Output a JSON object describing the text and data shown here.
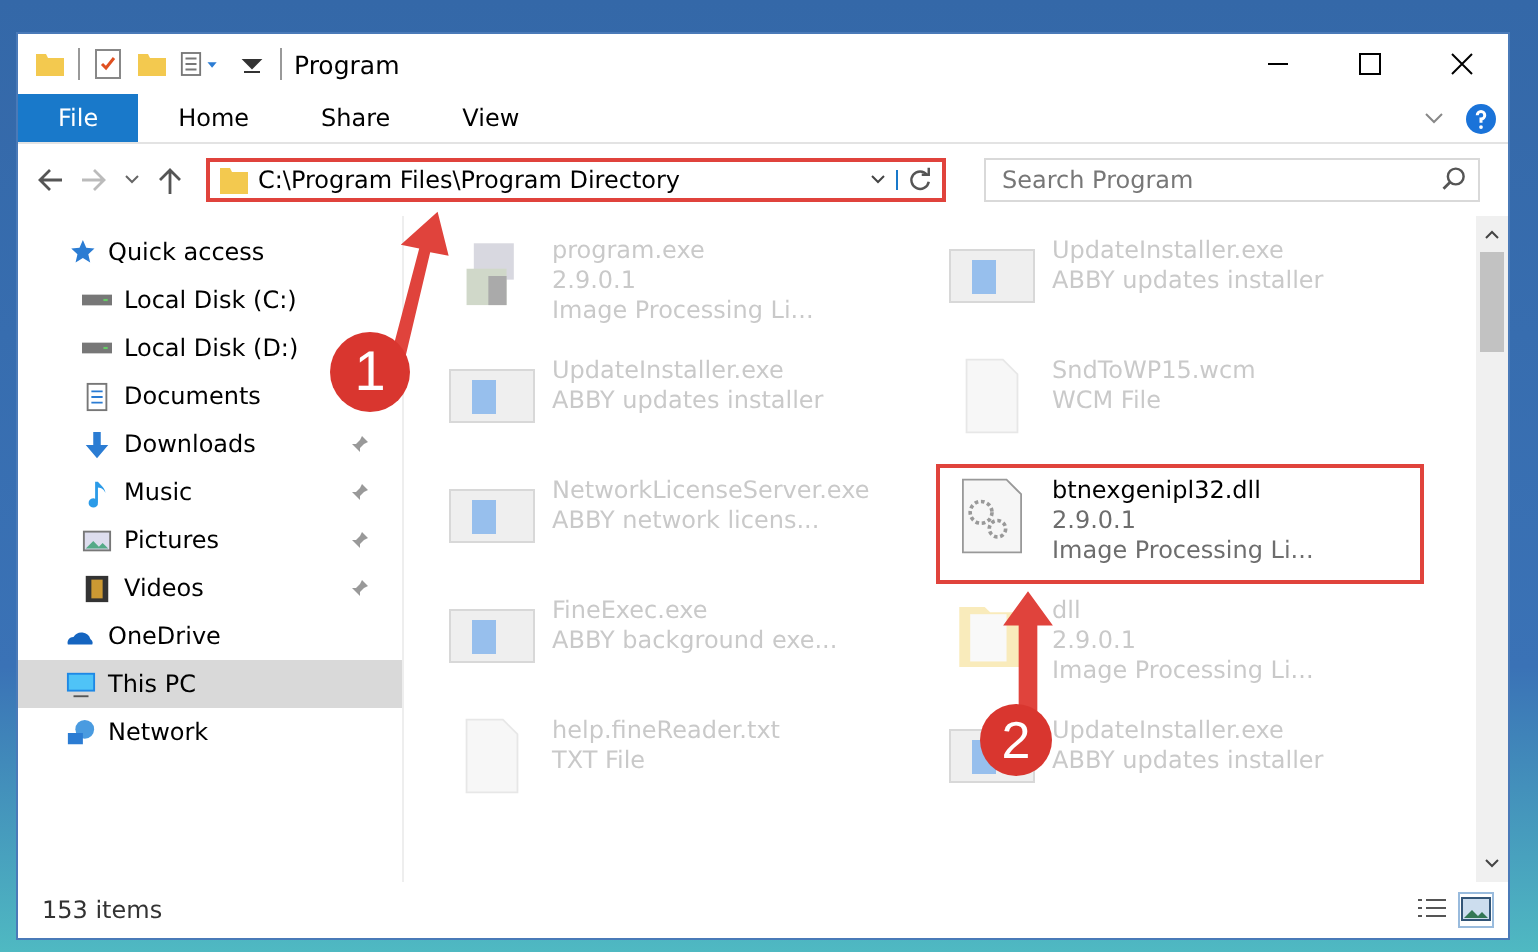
{
  "window": {
    "title": "Program"
  },
  "ribbon_tabs": [
    {
      "label": "File",
      "selected": true
    },
    {
      "label": "Home",
      "selected": false
    },
    {
      "label": "Share",
      "selected": false
    },
    {
      "label": "View",
      "selected": false
    }
  ],
  "address": {
    "value": "C:\\Program Files\\Program Directory"
  },
  "search": {
    "placeholder": "Search Program"
  },
  "sidebar": {
    "items": [
      {
        "label": "Quick access",
        "kind": "star",
        "selected": false,
        "children": [
          {
            "label": "Local Disk (C:)",
            "kind": "disk",
            "pinned": false,
            "selected": false
          },
          {
            "label": "Local Disk (D:)",
            "kind": "disk",
            "pinned": false,
            "selected": false
          },
          {
            "label": "Documents",
            "kind": "doc",
            "pinned": false,
            "selected": false
          },
          {
            "label": "Downloads",
            "kind": "download",
            "pinned": true,
            "selected": false
          },
          {
            "label": "Music",
            "kind": "music",
            "pinned": true,
            "selected": false
          },
          {
            "label": "Pictures",
            "kind": "pictures",
            "pinned": true,
            "selected": false
          },
          {
            "label": "Videos",
            "kind": "videos",
            "pinned": true,
            "selected": false
          }
        ]
      },
      {
        "label": "OneDrive",
        "kind": "cloud",
        "selected": false
      },
      {
        "label": "This PC",
        "kind": "pc",
        "selected": true
      },
      {
        "label": "Network",
        "kind": "network",
        "selected": false
      }
    ]
  },
  "files": [
    {
      "name": "program.exe",
      "details": [
        "2.9.0.1",
        "Image Processing Li..."
      ],
      "kind": "setup",
      "highlighted": false
    },
    {
      "name": "UpdateInstaller.exe",
      "details": [
        "ABBY updates installer"
      ],
      "kind": "app",
      "highlighted": false
    },
    {
      "name": "UpdateInstaller.exe",
      "details": [
        "ABBY updates installer"
      ],
      "kind": "app",
      "highlighted": false
    },
    {
      "name": "SndToWP15.wcm",
      "details": [
        "WCM File"
      ],
      "kind": "blank",
      "highlighted": false
    },
    {
      "name": "NetworkLicenseServer.exe",
      "details": [
        "ABBY network licens..."
      ],
      "kind": "app",
      "highlighted": false
    },
    {
      "name": "btnexgenipl32.dll",
      "details": [
        "2.9.0.1",
        "Image Processing Li..."
      ],
      "kind": "dll",
      "highlighted": true
    },
    {
      "name": "FineExec.exe",
      "details": [
        "ABBY background exe..."
      ],
      "kind": "app",
      "highlighted": false
    },
    {
      "name": "dll",
      "details": [
        "2.9.0.1",
        "Image Processing Li..."
      ],
      "kind": "folder",
      "highlighted": false
    },
    {
      "name": "help.fineReader.txt",
      "details": [
        "TXT File"
      ],
      "kind": "blank",
      "highlighted": false
    },
    {
      "name": "UpdateInstaller.exe",
      "details": [
        "ABBY updates installer"
      ],
      "kind": "app",
      "highlighted": false
    }
  ],
  "status_bar": {
    "item_count": "153 items"
  },
  "annotations": [
    {
      "label": "1"
    },
    {
      "label": "2"
    }
  ]
}
